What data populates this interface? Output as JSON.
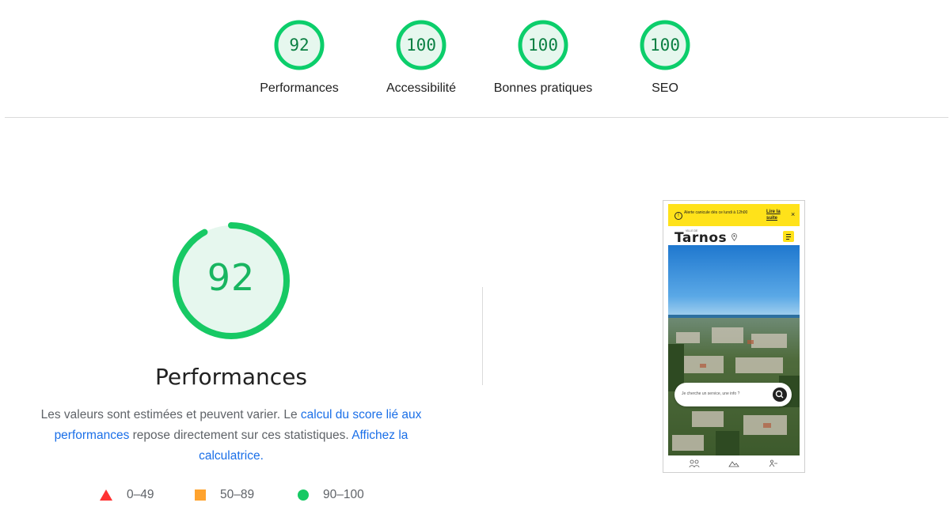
{
  "summary": {
    "gauges": [
      {
        "score": "92",
        "label": "Performances"
      },
      {
        "score": "100",
        "label": "Accessibilité"
      },
      {
        "score": "100",
        "label": "Bonnes pratiques"
      },
      {
        "score": "100",
        "label": "SEO"
      }
    ]
  },
  "performance": {
    "score": "92",
    "title": "Performances",
    "desc_text_1": "Les valeurs sont estimées et peuvent varier. Le ",
    "desc_link_1": "calcul du score lié aux performances",
    "desc_text_2": " repose directement sur ces statistiques. ",
    "desc_link_2": "Affichez la calculatrice."
  },
  "legend": [
    {
      "range": "0–49",
      "shape": "triangle",
      "color": "#ff3333"
    },
    {
      "range": "50–89",
      "shape": "square",
      "color": "#ffa32e"
    },
    {
      "range": "90–100",
      "shape": "circle",
      "color": "#17c964"
    }
  ],
  "screenshot": {
    "alert_message": "Alerte canicule dès ce lundi à 12h00",
    "alert_link": "Lire la suite",
    "alert_close": "×",
    "logo_small": "VILLE DE",
    "logo": "Tarnos",
    "search_placeholder": "Je cherche un service, une info ?"
  },
  "colors": {
    "good": "#0cce6b",
    "good_text": "#0b8043",
    "good_fill": "#e6f7ee",
    "link": "#1a6fe8",
    "alert_bg": "#ffe21a"
  }
}
